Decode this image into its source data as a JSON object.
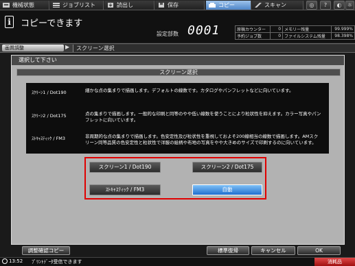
{
  "tabs": [
    {
      "label": "機械状態",
      "icon": "machine-icon"
    },
    {
      "label": "ジョブリスト",
      "icon": "job-list-icon"
    },
    {
      "label": "読出し",
      "icon": "retrieve-icon"
    },
    {
      "label": "保存",
      "icon": "save-icon"
    },
    {
      "label": "コピー",
      "icon": "copy-icon",
      "active": true
    },
    {
      "label": "スキャン",
      "icon": "scan-icon"
    }
  ],
  "header": {
    "message": "コピーできます",
    "copies_label": "設定部数",
    "copies_value": "0001"
  },
  "stats": [
    {
      "label": "原稿カウンター",
      "value": "0",
      "label2": "メモリー残量",
      "value2": "99.999%"
    },
    {
      "label": "予約ジョブ数",
      "value": "0",
      "label2": "ファイルシステム残量",
      "value2": "98.398%"
    }
  ],
  "breadcrumb": {
    "parent": "画質調整",
    "current": "スクリーン選択"
  },
  "panel": {
    "instruction": "選択して下さい",
    "title": "スクリーン選択",
    "descriptions": [
      {
        "name": "ｽｸﾘｰﾝ1 / Dot190",
        "text": "細かな点の集まりで描画します。デフォルトの線数です。カタログやパンフレットなどに向いています。"
      },
      {
        "name": "ｽｸﾘｰﾝ2 / Dot175",
        "text": "点の集まりで描画します。一般的な印刷と同等のやや低い線数を使うことにより粒状性を抑えます。カラー写真やパンフレットに向いています。"
      },
      {
        "name": "ｽﾄｷｬｽﾃｨｯｸ / FM3",
        "text": "非周期的な点の集まりで描画します。色安定性及び粒状性を重視しておよそ200線相当の線数で描画します。AMスクリーン同等品質の色安定性と粒状性で洋服の絵柄や布地の写真をやや大きめのサイズで印刷するのに向いています。"
      }
    ],
    "options": {
      "screen1": "スクリーン1 / Dot190",
      "screen2": "スクリーン2 / Dot175",
      "stochastic": "ｽﾄｷｬｽﾃｨｯｸ / FM3",
      "auto": "自動"
    },
    "selected": "auto"
  },
  "bottom": {
    "proof_copy": "調整確認コピー",
    "default": "標準復帰",
    "cancel": "キャンセル",
    "ok": "OK"
  },
  "status": {
    "time": "13:52",
    "message": "ﾌﾟﾘﾝﾄﾃﾞｰﾀ受信できます",
    "supplies": "消耗品"
  },
  "colors": {
    "accent_blue": "#1f6fd0",
    "highlight_red": "#e00000",
    "supplies_red": "#c02020"
  }
}
